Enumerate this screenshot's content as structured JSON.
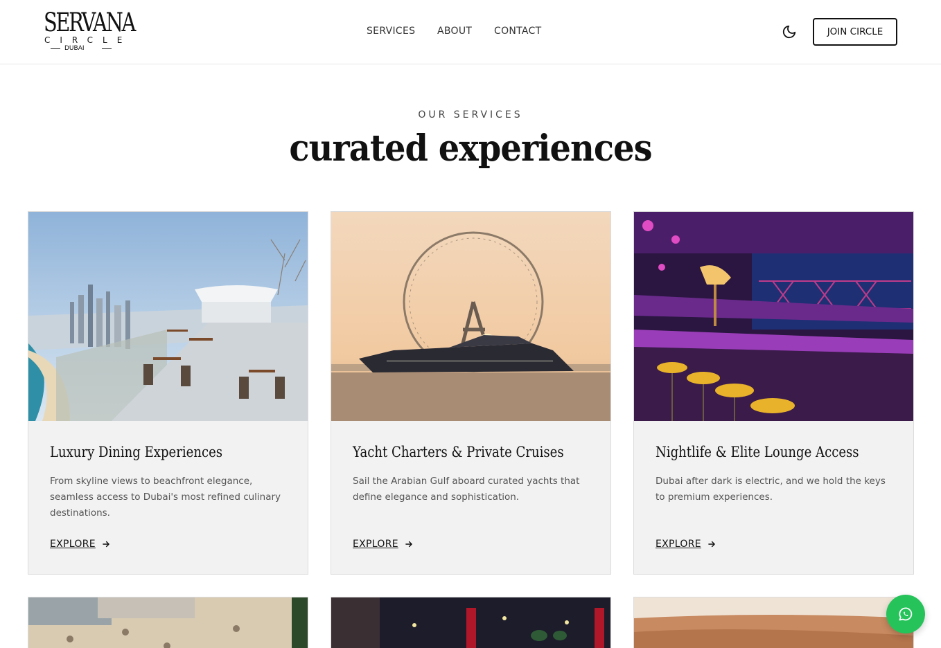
{
  "brand": {
    "name_line1": "SERVANA",
    "name_line2": "CIRCLE",
    "name_line3": "DUBAI"
  },
  "nav": {
    "items": [
      {
        "label": "SERVICES"
      },
      {
        "label": "ABOUT"
      },
      {
        "label": "CONTACT"
      }
    ],
    "theme_toggle_icon": "moon-icon",
    "join_label": "JOIN CIRCLE"
  },
  "section": {
    "eyebrow": "OUR SERVICES",
    "title": "curated experiences"
  },
  "cards": [
    {
      "title": "Luxury Dining Experiences",
      "description": "From skyline views to beachfront elegance, seamless access to Dubai's most refined culinary destinations.",
      "cta": "EXPLORE",
      "icon": "arrow-right-icon"
    },
    {
      "title": "Yacht Charters & Private Cruises",
      "description": "Sail the Arabian Gulf aboard curated yachts that define elegance and sophistication.",
      "cta": "EXPLORE",
      "icon": "arrow-right-icon"
    },
    {
      "title": "Nightlife & Elite Lounge Access",
      "description": "Dubai after dark is electric, and we hold the keys to premium experiences.",
      "cta": "EXPLORE",
      "icon": "arrow-right-icon"
    }
  ],
  "floating": {
    "whatsapp_icon": "whatsapp-icon",
    "color": "#25c35a"
  }
}
